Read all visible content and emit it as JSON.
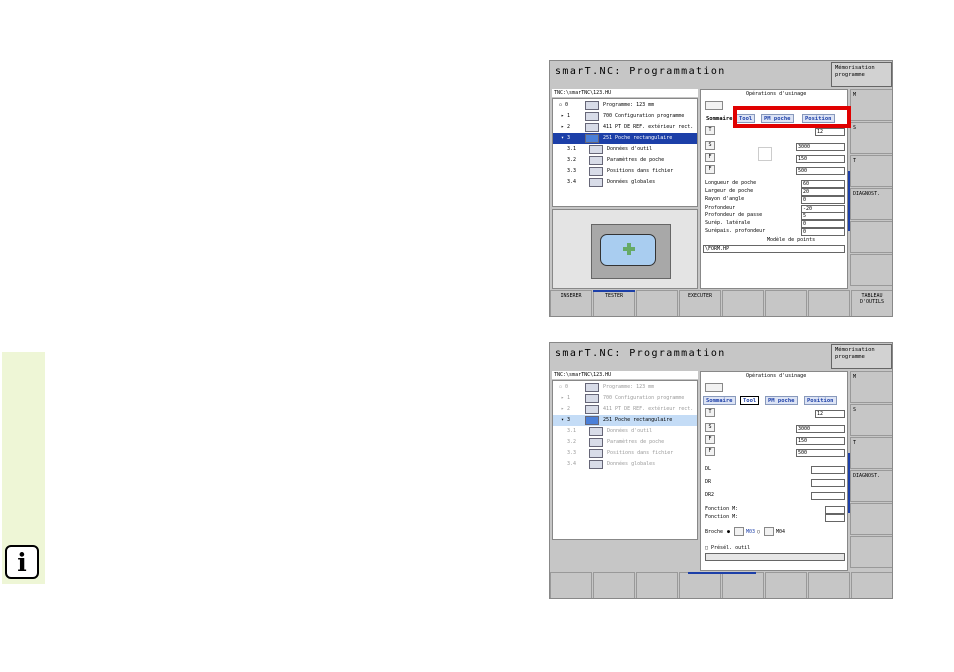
{
  "screen1": {
    "title": "smarT.NC: Programmation",
    "mode": "Mémorisation programme",
    "path": "TNC:\\smarTNC\\123.HU",
    "tree": [
      {
        "num": "0",
        "label": "Programme: 123 mm"
      },
      {
        "num": "1",
        "label": "700 Configuration programme"
      },
      {
        "num": "2",
        "label": "411 PT DE REF. extérieur rect."
      },
      {
        "num": "3",
        "label": "251 Poche rectangulaire"
      },
      {
        "num": "3.1",
        "label": "Données d'outil"
      },
      {
        "num": "3.2",
        "label": "Paramètres de poche"
      },
      {
        "num": "3.3",
        "label": "Positions dans fichier"
      },
      {
        "num": "3.4",
        "label": "Données globales"
      }
    ],
    "header": "Opérations d'usinage",
    "tabs": [
      "Sommaire",
      "Tool",
      "PM poche",
      "Position"
    ],
    "t_value": "12",
    "s_value": "3000",
    "f_value": "150",
    "f2_value": "500",
    "params": [
      {
        "label": "Longueur de poche",
        "value": "60"
      },
      {
        "label": "Largeur de poche",
        "value": "20"
      },
      {
        "label": "Rayon d'angle",
        "value": "0"
      },
      {
        "label": "Profondeur",
        "value": "-20"
      },
      {
        "label": "Profondeur de passe",
        "value": "5"
      },
      {
        "label": "Surép. latérale",
        "value": "0"
      },
      {
        "label": "Surépais. profondeur",
        "value": "0"
      }
    ],
    "pattern_label": "Modèle de points",
    "pattern_file": "\\FORM.HP",
    "softkeys_bottom": [
      "INSERER",
      "TESTER",
      "",
      "",
      "EXECUTER",
      "",
      "",
      "",
      "TABLEAU D'OUTILS"
    ],
    "softkeys_right": [
      "M",
      "S",
      "T",
      "DIAGNOST.",
      "",
      ""
    ]
  },
  "screen2": {
    "title": "smarT.NC: Programmation",
    "mode": "Mémorisation programme",
    "path": "TNC:\\smarTNC\\123.HU",
    "header": "Opérations d'usinage",
    "tabs": [
      "Sommaire",
      "Tool",
      "PM poche",
      "Position"
    ],
    "t_value": "12",
    "s_value": "3000",
    "f_value": "150",
    "f2_value": "500",
    "dl_label": "DL",
    "dr_label": "DR",
    "dr2_label": "DR2",
    "fonction_m1": "Fonction M:",
    "fonction_m2": "Fonction M:",
    "broche_label": "Broche",
    "m03": "M03",
    "m04": "M04",
    "presel": "Présél. outil"
  },
  "colors": {
    "accent": "#1c3fa8",
    "highlight": "#e00000",
    "sidebar": "#eef6d6"
  },
  "icons": {
    "info": "i"
  }
}
